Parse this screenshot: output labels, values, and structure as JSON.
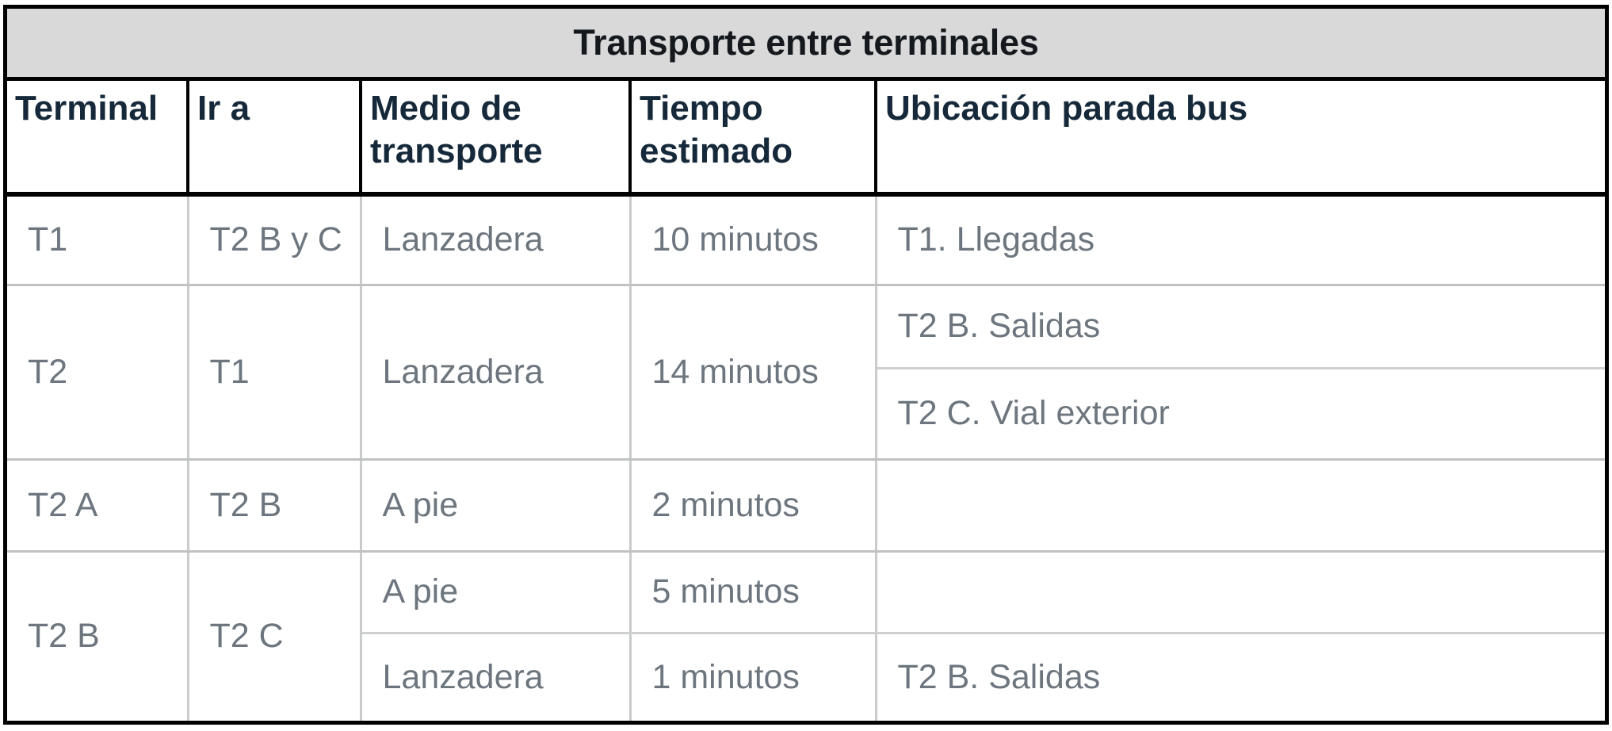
{
  "table": {
    "title": "Transporte entre terminales",
    "columns": [
      {
        "key": "terminal",
        "label": "Terminal"
      },
      {
        "key": "ir_a",
        "label": "Ir a"
      },
      {
        "key": "medio",
        "label": "Medio de transporte"
      },
      {
        "key": "tiempo",
        "label": "Tiempo estimado"
      },
      {
        "key": "ubicacion",
        "label": "Ubicación parada bus"
      }
    ],
    "column_labels_lines": {
      "terminal": "Terminal",
      "ir_a": "Ir a",
      "medio_line1": "Medio de",
      "medio_line2": "transporte",
      "tiempo_line1": "Tiempo",
      "tiempo_line2": "estimado",
      "ubicacion": "Ubicación parada bus"
    },
    "rows": [
      {
        "terminal": "T1",
        "ir_a": "T2 B y C",
        "medio": "Lanzadera",
        "tiempo": "10 minutos",
        "ubicacion": [
          "T1. Llegadas"
        ]
      },
      {
        "terminal": "T2",
        "ir_a": "T1",
        "medio": "Lanzadera",
        "tiempo": "14 minutos",
        "ubicacion": [
          "T2 B. Salidas",
          "T2 C. Vial exterior"
        ]
      },
      {
        "terminal": "T2 A",
        "ir_a": "T2 B",
        "medio": "A pie",
        "tiempo": "2 minutos",
        "ubicacion": [
          ""
        ]
      },
      {
        "terminal": "T2 B",
        "ir_a": "T2 C",
        "sub_rows": [
          {
            "medio": "A pie",
            "tiempo": "5 minutos",
            "ubicacion": ""
          },
          {
            "medio": "Lanzadera",
            "tiempo": "1 minutos",
            "ubicacion": "T2 B. Salidas"
          }
        ]
      }
    ],
    "colors": {
      "title_background": "#d9d9d9",
      "title_text": "#15181c",
      "header_text": "#16293a",
      "body_text": "#6d767e",
      "outer_border": "#000000",
      "inner_border": "#c9cbcc"
    }
  }
}
